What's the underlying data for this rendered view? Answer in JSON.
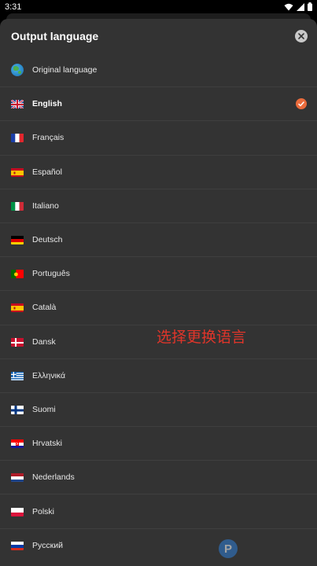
{
  "status_bar": {
    "time": "3:31"
  },
  "sheet": {
    "title": "Output language",
    "close_icon": "close-icon"
  },
  "languages": [
    {
      "label": "Original language",
      "icon": "globe-icon",
      "selected": false
    },
    {
      "label": "English",
      "icon": "flag-uk-icon",
      "selected": true
    },
    {
      "label": "Français",
      "icon": "flag-france-icon",
      "selected": false
    },
    {
      "label": "Español",
      "icon": "flag-spain-icon",
      "selected": false
    },
    {
      "label": "Italiano",
      "icon": "flag-italy-icon",
      "selected": false
    },
    {
      "label": "Deutsch",
      "icon": "flag-germany-icon",
      "selected": false
    },
    {
      "label": "Português",
      "icon": "flag-portugal-icon",
      "selected": false
    },
    {
      "label": "Català",
      "icon": "flag-catalonia-icon",
      "selected": false
    },
    {
      "label": "Dansk",
      "icon": "flag-denmark-icon",
      "selected": false
    },
    {
      "label": "Ελληνικά",
      "icon": "flag-greece-icon",
      "selected": false
    },
    {
      "label": "Suomi",
      "icon": "flag-finland-icon",
      "selected": false
    },
    {
      "label": "Hrvatski",
      "icon": "flag-croatia-icon",
      "selected": false
    },
    {
      "label": "Nederlands",
      "icon": "flag-netherlands-icon",
      "selected": false
    },
    {
      "label": "Polski",
      "icon": "flag-poland-icon",
      "selected": false
    },
    {
      "label": "Русский",
      "icon": "flag-russia-icon",
      "selected": false
    }
  ],
  "annotation": "选择更换语言",
  "colors": {
    "accent": "#ea6b3c",
    "sheet_background": "#333333",
    "annotation": "#e0352a"
  }
}
